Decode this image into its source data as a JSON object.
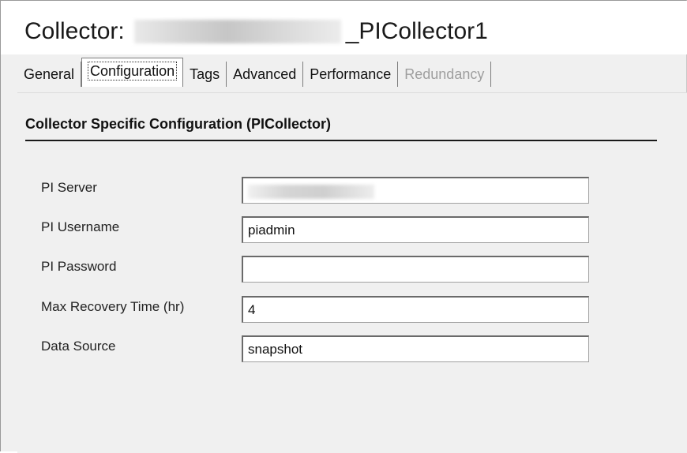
{
  "header": {
    "title_prefix": "Collector:",
    "title_suffix": "_PICollector1"
  },
  "tabs": [
    {
      "label": "General",
      "active": false,
      "enabled": true
    },
    {
      "label": "Configuration",
      "active": true,
      "enabled": true
    },
    {
      "label": "Tags",
      "active": false,
      "enabled": true
    },
    {
      "label": "Advanced",
      "active": false,
      "enabled": true
    },
    {
      "label": "Performance",
      "active": false,
      "enabled": true
    },
    {
      "label": "Redundancy",
      "active": false,
      "enabled": false
    }
  ],
  "section": {
    "title": "Collector Specific Configuration (PICollector)"
  },
  "fields": {
    "pi_server": {
      "label": "PI Server",
      "value": ""
    },
    "pi_username": {
      "label": "PI Username",
      "value": "piadmin"
    },
    "pi_password": {
      "label": "PI Password",
      "value": ""
    },
    "max_recovery": {
      "label": "Max Recovery Time (hr)",
      "value": "4"
    },
    "data_source": {
      "label": "Data Source",
      "value": "snapshot"
    }
  }
}
